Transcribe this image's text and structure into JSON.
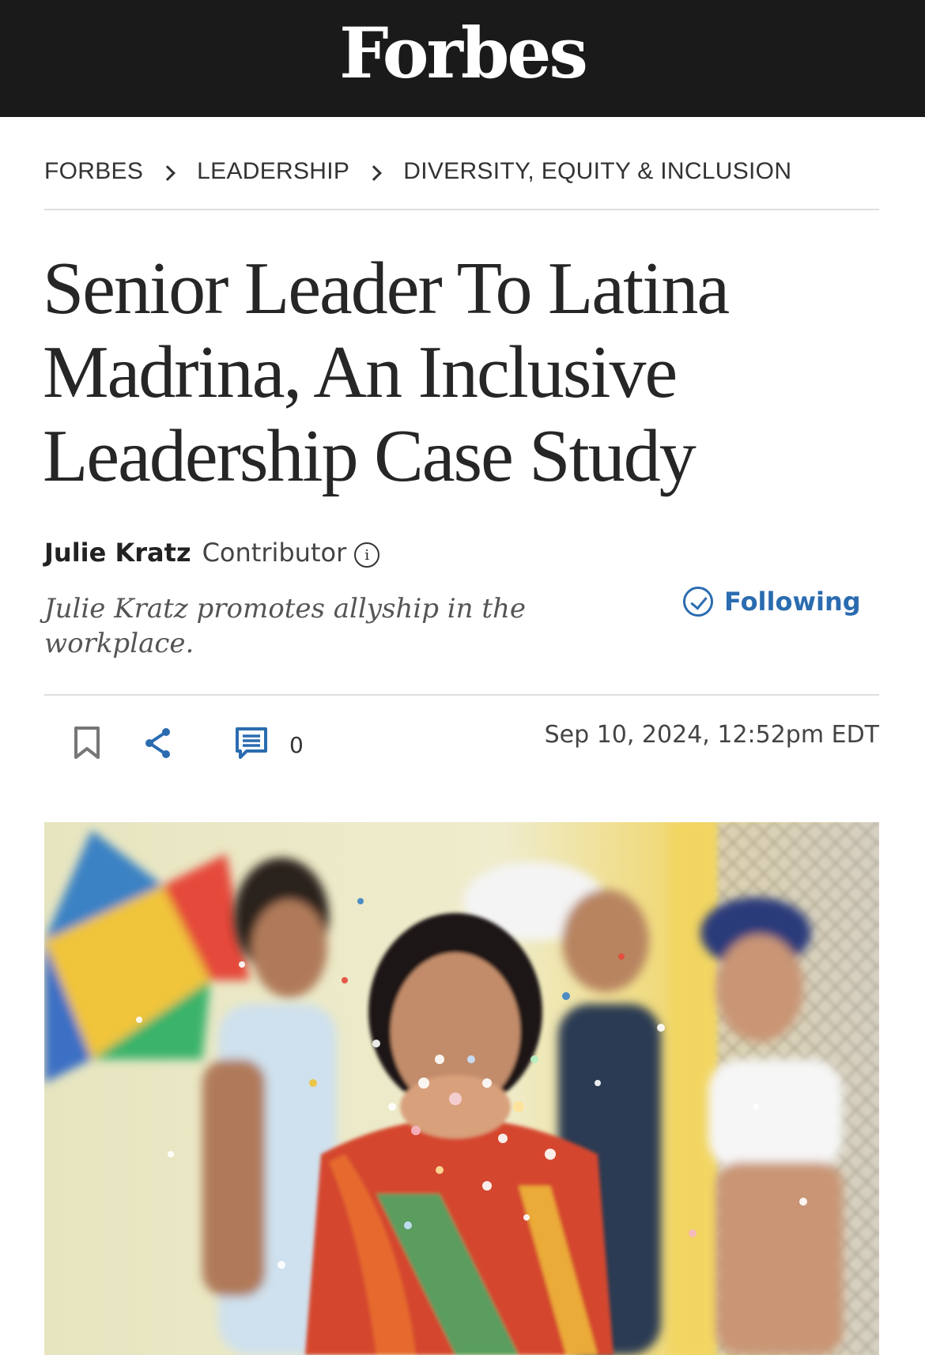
{
  "brand": {
    "name": "Forbes"
  },
  "breadcrumb": [
    {
      "label": "FORBES"
    },
    {
      "label": "LEADERSHIP"
    },
    {
      "label": "DIVERSITY, EQUITY & INCLUSION"
    }
  ],
  "article": {
    "title": "Senior Leader To Latina Madrina, An Inclusive Leadership Case Study",
    "author": {
      "name": "Julie Kratz",
      "role": "Contributor",
      "bio": "Julie Kratz promotes allyship in the workplace."
    },
    "follow_label": "Following",
    "comment_count": "0",
    "timestamp": "Sep 10, 2024, 12:52pm EDT"
  },
  "icons": {
    "info": "info-icon",
    "check": "check-circle-icon",
    "bookmark": "bookmark-icon",
    "share": "share-icon",
    "comment": "comment-icon"
  },
  "colors": {
    "header_bg": "#1a1a1a",
    "accent": "#2b6cb0",
    "text": "#262626"
  }
}
